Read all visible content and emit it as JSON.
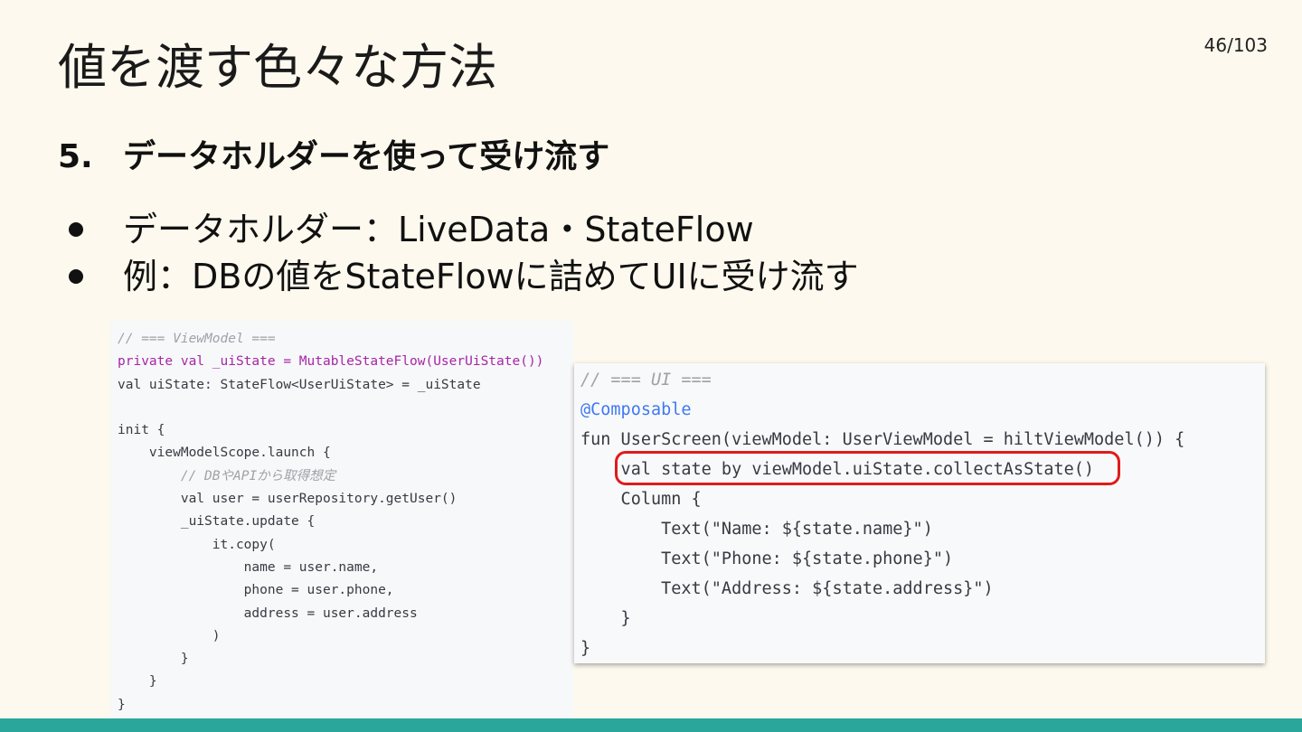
{
  "slide": {
    "title": "値を渡す色々な方法",
    "page_number": "46/103",
    "heading_number": "5.",
    "heading_text": "データホルダーを使って受け流す",
    "bullets": [
      "データホルダー：LiveData・StateFlow",
      "例：DBの値をStateFlowに詰めてUIに受け流す"
    ]
  },
  "code_viewmodel": {
    "lines": [
      "// === ViewModel ===",
      "private val _uiState = MutableStateFlow(UserUiState())",
      "val uiState: StateFlow<UserUiState> = _uiState",
      "",
      "init {",
      "    viewModelScope.launch {",
      "        // DBやAPIから取得想定",
      "        val user = userRepository.getUser()",
      "        _uiState.update {",
      "            it.copy(",
      "                name = user.name,",
      "                phone = user.phone,",
      "                address = user.address",
      "            )",
      "        }",
      "    }",
      "}"
    ]
  },
  "code_ui": {
    "lines": [
      "// === UI ===",
      "@Composable",
      "fun UserScreen(viewModel: UserViewModel = hiltViewModel()) {",
      "    val state by viewModel.uiState.collectAsState()",
      "    Column {",
      "        Text(\"Name: ${state.name}\")",
      "        Text(\"Phone: ${state.phone}\")",
      "        Text(\"Address: ${state.address}\")",
      "    }",
      "}"
    ]
  },
  "colors": {
    "background": "#fdf9ee",
    "footer_bar": "#2aa79a",
    "highlight": "#e01b1b",
    "keyword": "#a626a4",
    "function": "#4078f2",
    "type": "#c18401",
    "string": "#50a14f",
    "template": "#e45649",
    "comment": "#a0a1a7"
  }
}
